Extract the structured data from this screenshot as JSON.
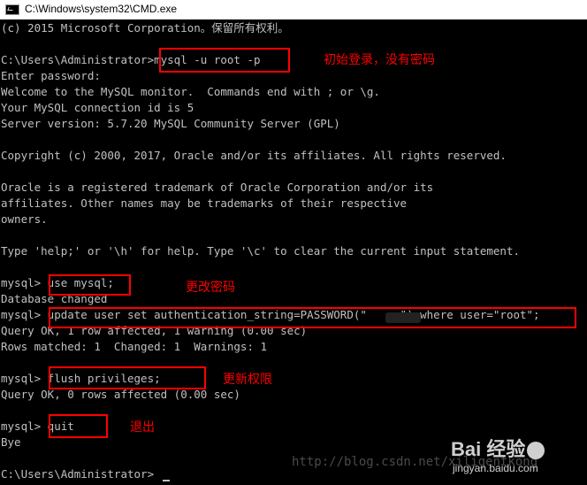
{
  "window": {
    "title": "C:\\Windows\\system32\\CMD.exe",
    "icon": "cmd-icon"
  },
  "terminal": {
    "lines": [
      "(c) 2015 Microsoft Corporation。保留所有权利。",
      "",
      "C:\\Users\\Administrator>mysql -u root -p",
      "Enter password:",
      "Welcome to the MySQL monitor.  Commands end with ; or \\g.",
      "Your MySQL connection id is 5",
      "Server version: 5.7.20 MySQL Community Server (GPL)",
      "",
      "Copyright (c) 2000, 2017, Oracle and/or its affiliates. All rights reserved.",
      "",
      "Oracle is a registered trademark of Oracle Corporation and/or its",
      "affiliates. Other names may be trademarks of their respective",
      "owners.",
      "",
      "Type 'help;' or '\\h' for help. Type '\\c' to clear the current input statement.",
      "",
      "mysql> use mysql;",
      "Database changed",
      "mysql> update user set authentication_string=PASSWORD(\"     \") where user=\"root\";",
      "Query OK, 1 row affected, 1 warning (0.00 sec)",
      "Rows matched: 1  Changed: 1  Warnings: 1",
      "",
      "mysql> flush privileges;",
      "Query OK, 0 rows affected (0.00 sec)",
      "",
      "mysql> quit",
      "Bye",
      "",
      "C:\\Users\\Administrator>"
    ]
  },
  "annotations": {
    "login": "初始登录，没有密码",
    "change_password": "更改密码",
    "refresh_privileges": "更新权限",
    "exit": "退出"
  },
  "watermark": {
    "url": "http://blog.csdn.net/xiligentkong",
    "brand": "Bai  经验",
    "domain": "jingyan.baidu.com"
  },
  "colors": {
    "terminal_bg": "#000000",
    "terminal_fg": "#c0c0c0",
    "highlight": "#ff0000"
  }
}
